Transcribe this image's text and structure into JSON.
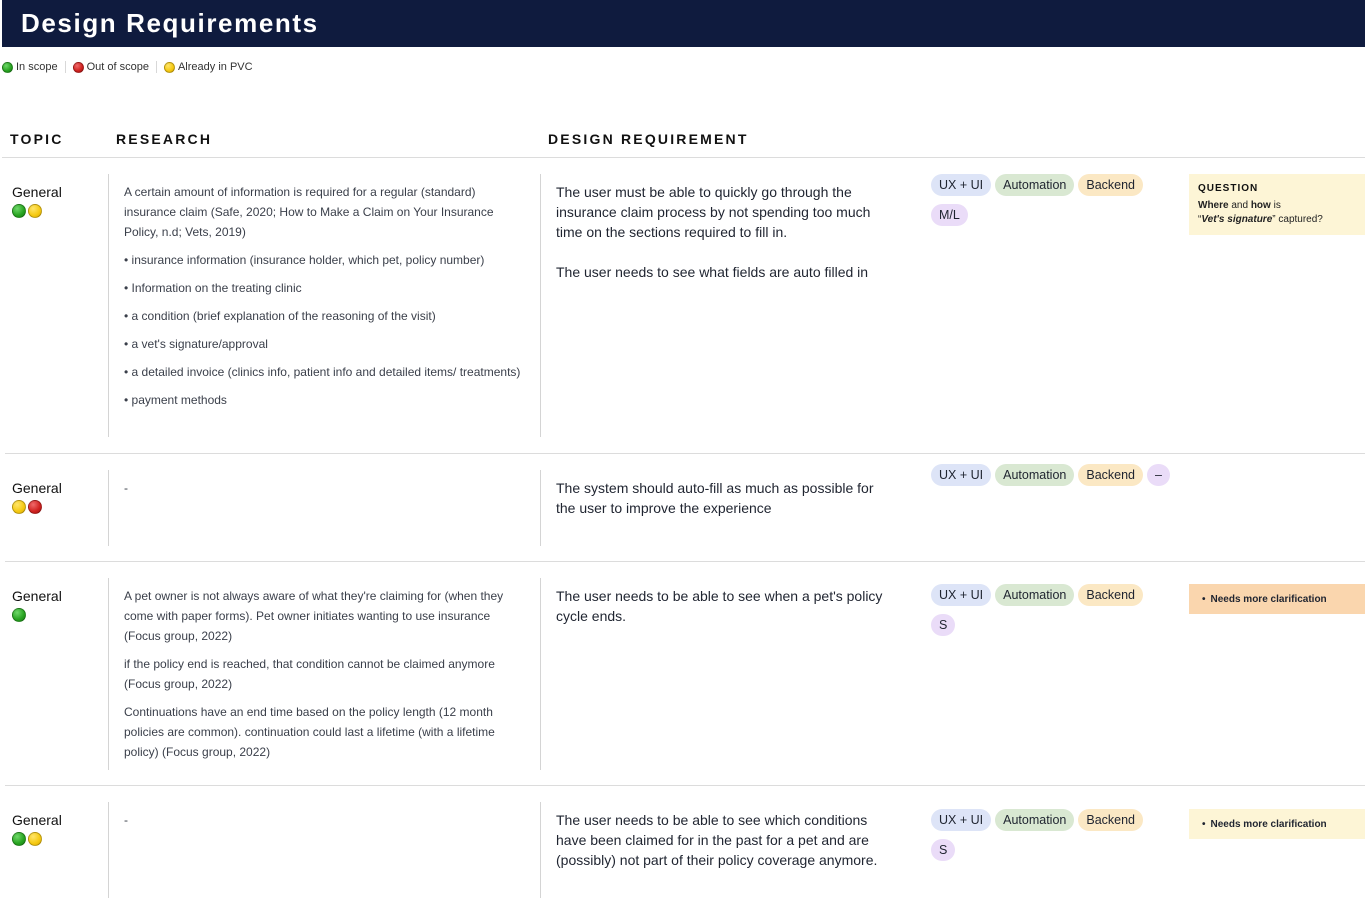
{
  "header": {
    "title": "Design Requirements"
  },
  "legend": [
    {
      "color": "green",
      "label": "In scope"
    },
    {
      "color": "red",
      "label": "Out of scope"
    },
    {
      "color": "yellow",
      "label": "Already in PVC"
    }
  ],
  "columns": {
    "topic": "TOPIC",
    "research": "RESEARCH",
    "design": "DESIGN REQUIREMENT"
  },
  "tags": {
    "ux": "UX + UI",
    "automation": "Automation",
    "backend": "Backend"
  },
  "rows": [
    {
      "topic": "General",
      "status": [
        "green",
        "yellow"
      ],
      "research": [
        "A certain amount of information is required for a regular (standard) insurance claim (Safe, 2020; How to Make a Claim on Your Insurance Policy, n.d; Vets, 2019)",
        "• insurance information (insurance holder, which pet, policy number)",
        "• Information on the treating clinic",
        "• a condition (brief explanation of the reasoning of the visit)",
        "• a vet's signature/approval",
        "• a detailed invoice (clinics info, patient info and detailed items/ treatments)",
        "• payment methods"
      ],
      "design": [
        "The user must be able to quickly go through the insurance claim process by not spending too much time on the sections required to fill in.",
        "The user needs to see what fields are auto filled in"
      ],
      "size": "M/L",
      "note": {
        "type": "question",
        "title": "QUESTION",
        "text": "captured?",
        "where": "Where",
        "and": "and",
        "how": "how",
        "is": "is",
        "quote_open": "“",
        "quote_close": "”",
        "signature": "Vet's signature"
      }
    },
    {
      "topic": "General",
      "status": [
        "yellow",
        "red"
      ],
      "research": [
        "-"
      ],
      "design": [
        "The system should auto-fill as much as possible for the user to improve the experience"
      ],
      "size": "–"
    },
    {
      "topic": "General",
      "status": [
        "green"
      ],
      "research": [
        "A pet owner is not always aware of what they're claiming for (when they come with paper forms). Pet owner initiates wanting to use insurance (Focus group, 2022)",
        "if the policy end is reached, that condition cannot be claimed anymore (Focus group, 2022)",
        "Continuations have an end time based on the policy length (12 month policies are common). continuation could last a lifetime (with a lifetime policy) (Focus group, 2022)"
      ],
      "design": [
        "The user needs to be able to see when a pet's policy cycle ends."
      ],
      "size": "S",
      "note": {
        "type": "clarify",
        "bullet": "•",
        "text": "Needs more clarification",
        "color": "#fad6ae"
      }
    },
    {
      "topic": "General",
      "status": [
        "green",
        "yellow"
      ],
      "research": [
        "-"
      ],
      "design": [
        "The user needs to be able to see which conditions have been claimed for in the past for a pet and are (possibly) not part of their policy coverage anymore."
      ],
      "size": "S",
      "note": {
        "type": "clarify",
        "bullet": "•",
        "text": "Needs more clarification",
        "color": "#fdf5d6"
      }
    }
  ]
}
